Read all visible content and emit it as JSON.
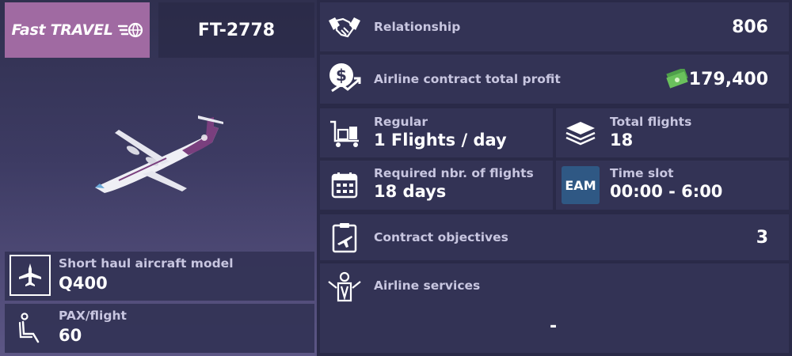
{
  "contract": {
    "logo_text": "Fast TRAVEL",
    "code": "FT-2778"
  },
  "aircraft": {
    "model_label": "Short haul aircraft model",
    "model_value": "Q400",
    "pax_label": "PAX/flight",
    "pax_value": "60"
  },
  "relationship": {
    "label": "Relationship",
    "value": "806"
  },
  "profit": {
    "label": "Airline contract total profit",
    "value": "179,400"
  },
  "regular": {
    "label": "Regular",
    "value": "1 Flights / day"
  },
  "total_flights": {
    "label": "Total flights",
    "value": "18"
  },
  "required": {
    "label": "Required nbr. of flights",
    "value": "18 days"
  },
  "time_slot": {
    "label": "Time slot",
    "badge": "EAM",
    "value": "00:00 - 6:00"
  },
  "objectives": {
    "label": "Contract objectives",
    "value": "3"
  },
  "services": {
    "label": "Airline services",
    "value": "-"
  },
  "colors": {
    "logo_bg": "#a06aa2",
    "eam_badge": "#2f5884",
    "panel": "#343456"
  }
}
